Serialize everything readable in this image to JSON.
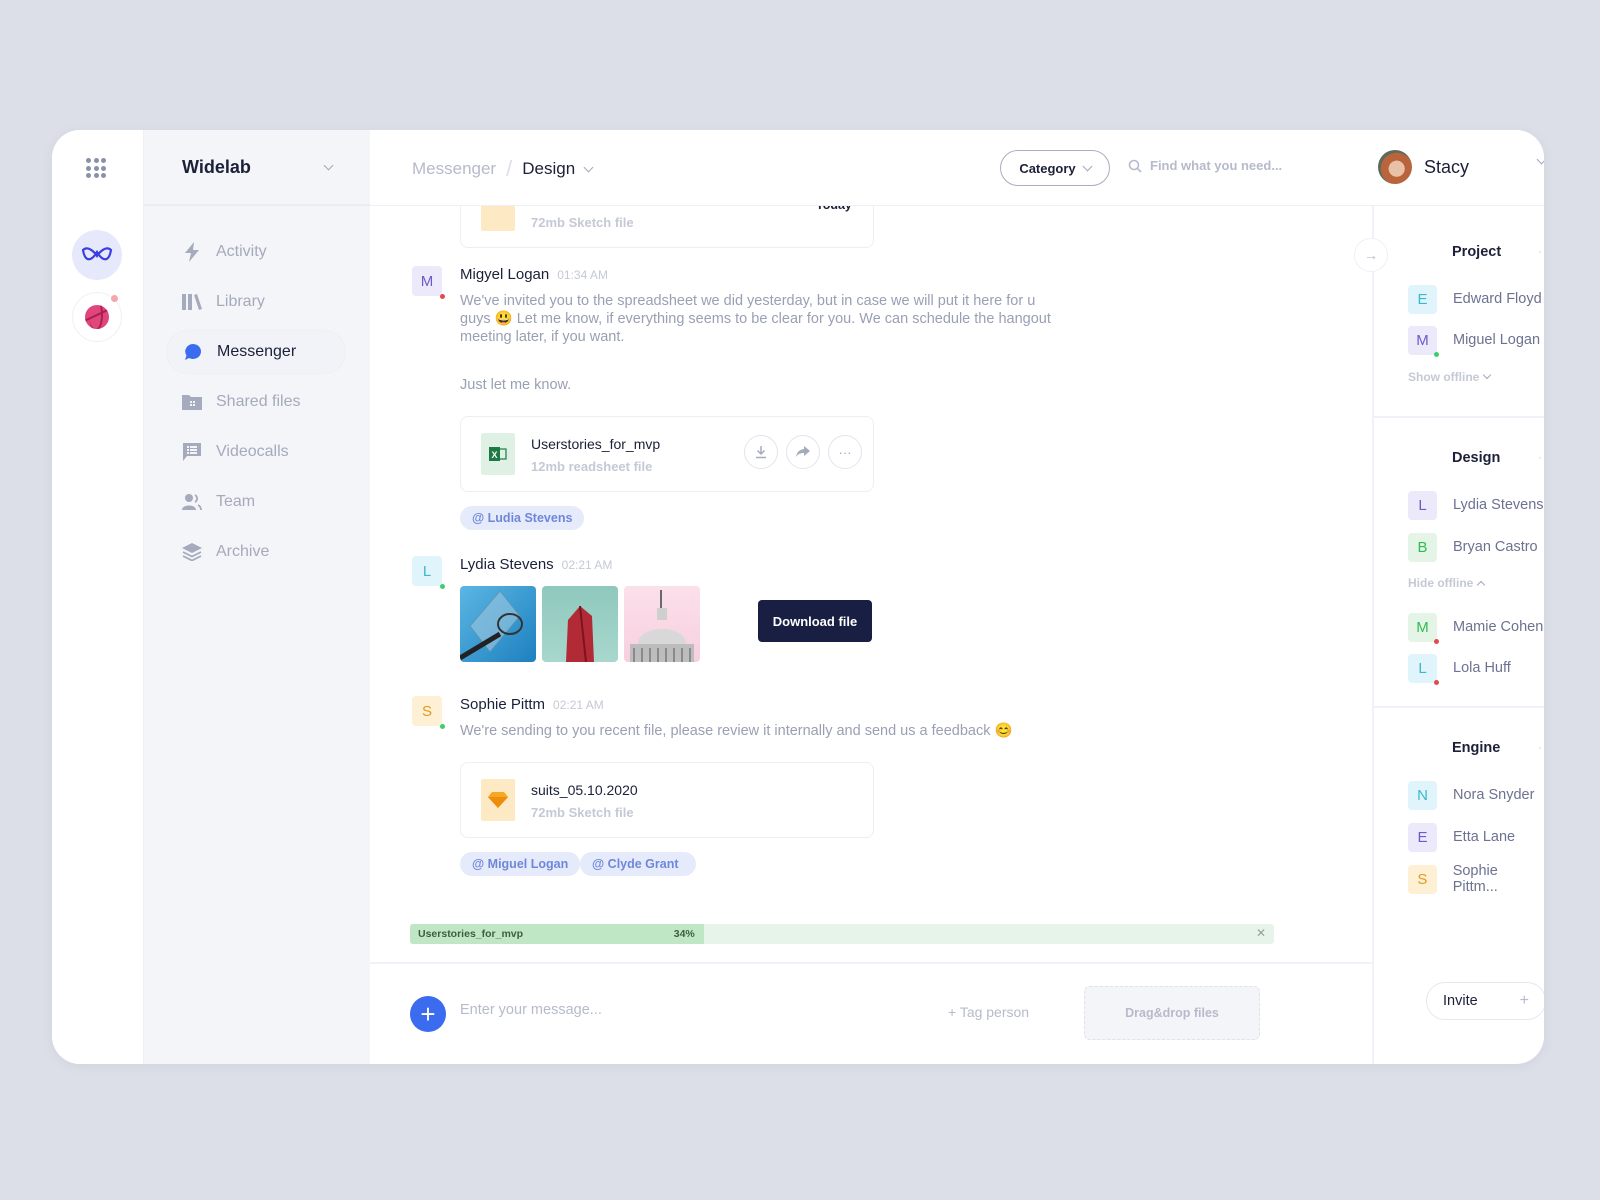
{
  "workspace": {
    "name": "Widelab"
  },
  "rail": {
    "workspaces": [
      "widelab-logo",
      "dribbble-logo"
    ]
  },
  "nav": {
    "items": [
      {
        "label": "Activity",
        "icon": "lightning-icon",
        "active": false
      },
      {
        "label": "Library",
        "icon": "library-icon",
        "active": false
      },
      {
        "label": "Messenger",
        "icon": "chat-bubble-icon",
        "active": true
      },
      {
        "label": "Shared files",
        "icon": "folder-icon",
        "active": false
      },
      {
        "label": "Videocalls",
        "icon": "message-list-icon",
        "active": false
      },
      {
        "label": "Team",
        "icon": "team-icon",
        "active": false
      },
      {
        "label": "Archive",
        "icon": "layers-icon",
        "active": false
      }
    ]
  },
  "header": {
    "breadcrumb": [
      "Messenger",
      "Design"
    ],
    "category_label": "Category",
    "search_placeholder": "Find what you need...",
    "user_name": "Stacy"
  },
  "chat": {
    "prev_file": {
      "size": "72mb Sketch file"
    },
    "date_divider": "Today",
    "messages": [
      {
        "author": "Migyel Logan",
        "initial": "M",
        "time": "01:34 AM",
        "text_lines": [
          "We've invited you to the spreadsheet we did yesterday, but in case we will put it here for u",
          "guys 😃  Let me know, if everything seems to be clear for you. We can schedule the hangout",
          "meeting later, if you want."
        ],
        "text2": "Just let me know.",
        "file": {
          "name": "Userstories_for_mvp",
          "size": "12mb readsheet file",
          "type": "excel"
        },
        "tooltip": "Download file",
        "tags": [
          "@ Ludia Stevens"
        ]
      },
      {
        "author": "Lydia Stevens",
        "initial": "L",
        "time": "02:21 AM",
        "images": [
          "basketball-hoop",
          "red-building",
          "dome"
        ]
      },
      {
        "author": "Sophie Pittm",
        "initial": "S",
        "time": "02:21 AM",
        "text": "We're sending to you recent file, please review it internally and send us a feedback  😊",
        "file": {
          "name": "suits_05.10.2020",
          "size": "72mb Sketch file",
          "type": "sketch"
        },
        "tags": [
          "@ Miguel Logan",
          "@ Clyde Grant"
        ]
      }
    ]
  },
  "upload": {
    "name": "Userstories_for_mvp",
    "percent_label": "34%",
    "progress": 0.34
  },
  "composer": {
    "placeholder": "Enter your message...",
    "tag_person": "+ Tag person",
    "drop_label": "Drag&drop files"
  },
  "groups": [
    {
      "title": "Project",
      "members": [
        {
          "initial": "E",
          "name": "Edward Floyd",
          "status": ""
        },
        {
          "initial": "M",
          "name": "Miguel Logan",
          "status": "online"
        }
      ],
      "toggle": "Show offline"
    },
    {
      "title": "Design",
      "members": [
        {
          "initial": "L",
          "name": "Lydia Stevens",
          "status": ""
        },
        {
          "initial": "B",
          "name": "Bryan Castro",
          "status": ""
        }
      ],
      "toggle": "Hide offline",
      "offline": [
        {
          "initial": "M",
          "name": "Mamie Cohen",
          "status": "offline"
        },
        {
          "initial": "L",
          "name": "Lola Huff",
          "status": "offline"
        }
      ]
    },
    {
      "title": "Engine",
      "members": [
        {
          "initial": "N",
          "name": "Nora Snyder",
          "status": ""
        },
        {
          "initial": "E",
          "name": "Etta Lane",
          "status": ""
        },
        {
          "initial": "S",
          "name": "Sophie Pittm...",
          "status": ""
        }
      ]
    }
  ],
  "invite_label": "Invite",
  "colors": {
    "accent": "#3b6cf0",
    "online": "#3ccf6e",
    "offline": "#e5484d",
    "tooltip": "#181f42",
    "progress": "#bfe7c6"
  }
}
